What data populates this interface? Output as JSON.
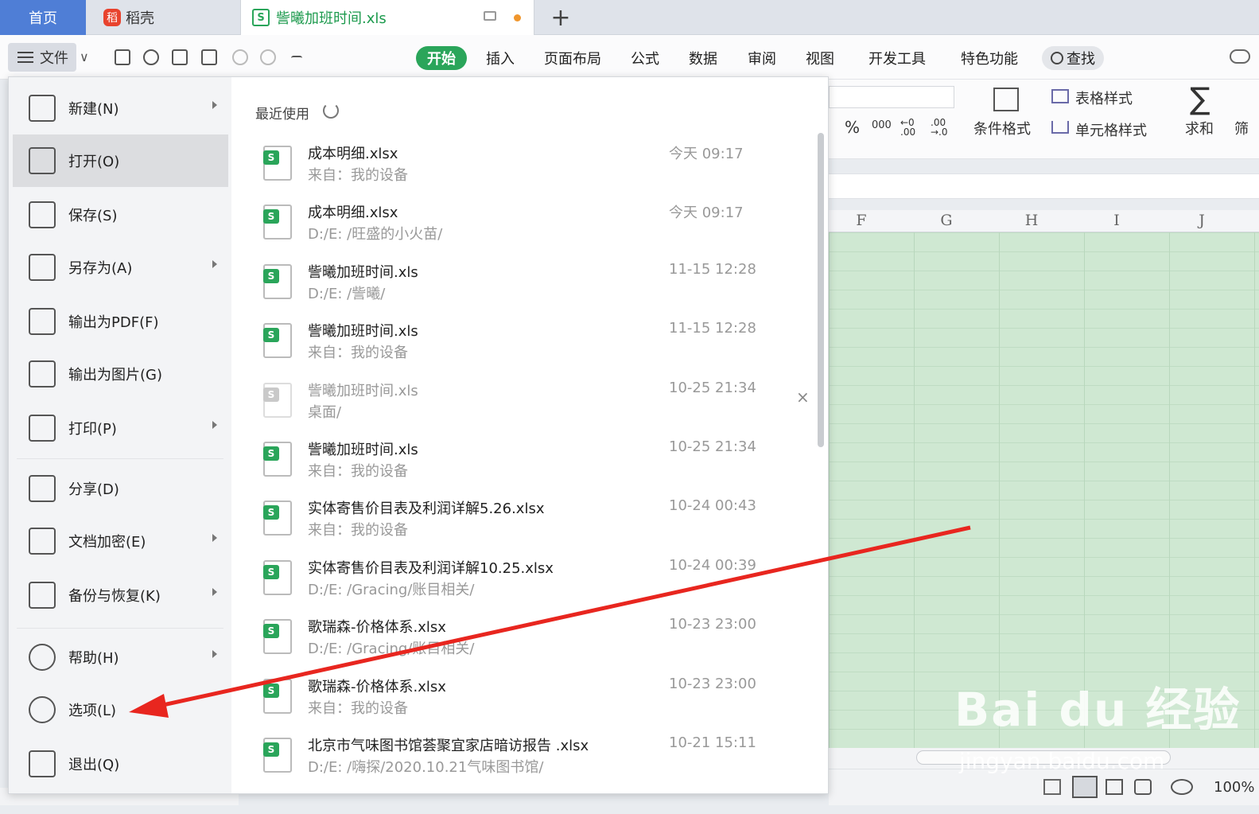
{
  "tabs": {
    "home": "首页",
    "daoke": "稻壳",
    "daoke_logo": "稻",
    "doc": "訾曦加班时间.xls",
    "doc_icon": "S",
    "add": "+"
  },
  "toolbar": {
    "file_label": "文件",
    "file_chevron": "∨"
  },
  "menu_tabs": [
    "开始",
    "插入",
    "页面布局",
    "公式",
    "数据",
    "审阅",
    "视图",
    "开发工具",
    "特色功能",
    "查找"
  ],
  "ribbon": {
    "percent": "%",
    "thousands": "000",
    "dec_inc": "←0 .00",
    "dec_dec": ".00 →.0",
    "cond_format": "条件格式",
    "table_style": "表格样式",
    "cell_style": "单元格样式",
    "sum_symbol": "∑",
    "sum": "求和",
    "filter_partial": "筛"
  },
  "columns": [
    "F",
    "G",
    "H",
    "I",
    "J"
  ],
  "file_menu": {
    "items": [
      {
        "label": "新建(N)",
        "icon": "new-file-icon",
        "submenu": true
      },
      {
        "label": "打开(O)",
        "icon": "open-folder-icon",
        "submenu": false,
        "active": true
      },
      {
        "label": "保存(S)",
        "icon": "save-icon",
        "submenu": false
      },
      {
        "label": "另存为(A)",
        "icon": "save-as-icon",
        "submenu": true
      },
      {
        "label": "输出为PDF(F)",
        "icon": "export-pdf-icon",
        "submenu": false
      },
      {
        "label": "输出为图片(G)",
        "icon": "export-image-icon",
        "submenu": false
      },
      {
        "label": "打印(P)",
        "icon": "print-icon",
        "submenu": true
      },
      {
        "label": "分享(D)",
        "icon": "share-icon",
        "submenu": false
      },
      {
        "label": "文档加密(E)",
        "icon": "encrypt-icon",
        "submenu": true
      },
      {
        "label": "备份与恢复(K)",
        "icon": "backup-icon",
        "submenu": true
      },
      {
        "label": "帮助(H)",
        "icon": "help-icon",
        "submenu": true
      },
      {
        "label": "选项(L)",
        "icon": "gear-icon",
        "submenu": false
      },
      {
        "label": "退出(Q)",
        "icon": "exit-icon",
        "submenu": false
      }
    ],
    "recent_title": "最近使用",
    "recent": [
      {
        "name": "成本明细.xlsx",
        "source": "来自：我的设备",
        "time": "今天 09:17",
        "cloud": true
      },
      {
        "name": "成本明细.xlsx",
        "source": "D:/E:  /旺盛的小火苗/",
        "time": "今天 09:17",
        "cloud": false
      },
      {
        "name": "訾曦加班时间.xls",
        "source": "D:/E:  /訾曦/",
        "time": "11-15 12:28",
        "cloud": false
      },
      {
        "name": "訾曦加班时间.xls",
        "source": "来自：我的设备",
        "time": "11-15 12:28",
        "cloud": true
      },
      {
        "name": "訾曦加班时间.xls",
        "source": "桌面/",
        "time": "10-25 21:34",
        "cloud": false,
        "dim": true
      },
      {
        "name": "訾曦加班时间.xls",
        "source": "来自：我的设备",
        "time": "10-25 21:34",
        "cloud": true
      },
      {
        "name": "实体寄售价目表及利润详解5.26.xlsx",
        "source": "来自：我的设备",
        "time": "10-24 00:43",
        "cloud": true
      },
      {
        "name": "实体寄售价目表及利润详解10.25.xlsx",
        "source": "D:/E:  /Gracing/账目相关/",
        "time": "10-24 00:39",
        "cloud": false
      },
      {
        "name": "歌瑞森-价格体系.xlsx",
        "source": "D:/E:  /Gracing/账目相关/",
        "time": "10-23 23:00",
        "cloud": false
      },
      {
        "name": "歌瑞森-价格体系.xlsx",
        "source": "来自：我的设备",
        "time": "10-23 23:00",
        "cloud": true
      },
      {
        "name": "北京市气味图书馆荟聚宜家店暗访报告 .xlsx",
        "source": "D:/E:  /嗨探/2020.10.21气味图书馆/",
        "time": "10-21 15:11",
        "cloud": false
      }
    ],
    "close": "×"
  },
  "status": {
    "zoom": "100%"
  },
  "watermark": {
    "brand": "Bai du 经验",
    "url": "jingyan.baidu.com"
  },
  "colors": {
    "accent": "#2aa55a",
    "home_tab": "#4f7ed6",
    "arrow": "#e8261f"
  }
}
